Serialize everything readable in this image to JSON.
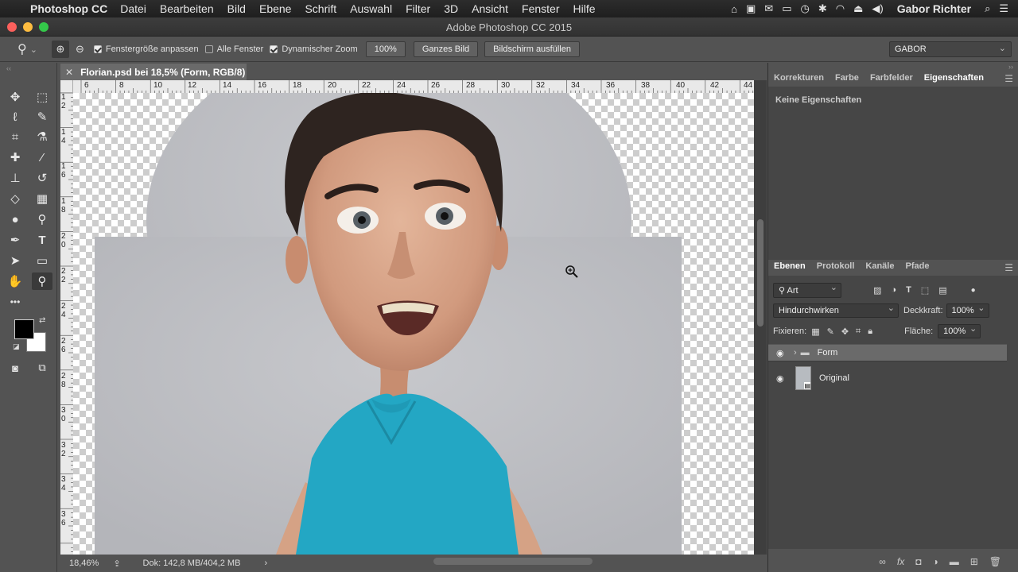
{
  "menubar": {
    "apple_icon": "apple-icon",
    "app_name": "Photoshop CC",
    "items": [
      "Datei",
      "Bearbeiten",
      "Bild",
      "Ebene",
      "Schrift",
      "Auswahl",
      "Filter",
      "3D",
      "Ansicht",
      "Fenster",
      "Hilfe"
    ],
    "user": "Gabor Richter"
  },
  "window": {
    "title": "Adobe Photoshop CC 2015"
  },
  "options": {
    "fit_window": "Fenstergröße anpassen",
    "all_windows": "Alle Fenster",
    "scrubby_zoom": "Dynamischer Zoom",
    "zoom_value": "100%",
    "fit_screen_button": "Ganzes Bild",
    "fill_screen_button": "Bildschirm ausfüllen",
    "workspace": "GABOR"
  },
  "document": {
    "tab_title": "Florian.psd bei 18,5% (Form, RGB/8)",
    "ruler_h": [
      "6",
      "8",
      "10",
      "12",
      "14",
      "16",
      "18",
      "20",
      "22",
      "24",
      "26",
      "28",
      "30",
      "32",
      "34",
      "36",
      "38",
      "40",
      "42",
      "44"
    ],
    "ruler_v": [
      "1 2",
      "1 4",
      "1 6",
      "1 8",
      "2 0",
      "2 2",
      "2 4",
      "2 6",
      "2 8",
      "3 0",
      "3 2",
      "3 4",
      "3 6"
    ],
    "status_zoom": "18,46%",
    "status_doc": "Dok: 142,8 MB/404,2 MB"
  },
  "panel_top": {
    "tabs": [
      "Korrekturen",
      "Farbe",
      "Farbfelder",
      "Eigenschaften"
    ],
    "active_tab": 3,
    "message": "Keine Eigenschaften"
  },
  "layers_panel": {
    "tabs": [
      "Ebenen",
      "Protokoll",
      "Kanäle",
      "Pfade"
    ],
    "active_tab": 0,
    "filter_kind": "Art",
    "blend_mode": "Hindurchwirken",
    "opacity_label": "Deckkraft:",
    "opacity_value": "100%",
    "lock_label": "Fixieren:",
    "fill_label": "Fläche:",
    "fill_value": "100%",
    "layers": [
      {
        "name": "Form",
        "type": "group",
        "selected": true
      },
      {
        "name": "Original",
        "type": "smart-object",
        "selected": false
      }
    ]
  },
  "colors": {
    "shirt": "#23a7c4",
    "background_gray": "#bcbdc2",
    "foreground_swatch": "#000000",
    "background_swatch": "#ffffff"
  }
}
